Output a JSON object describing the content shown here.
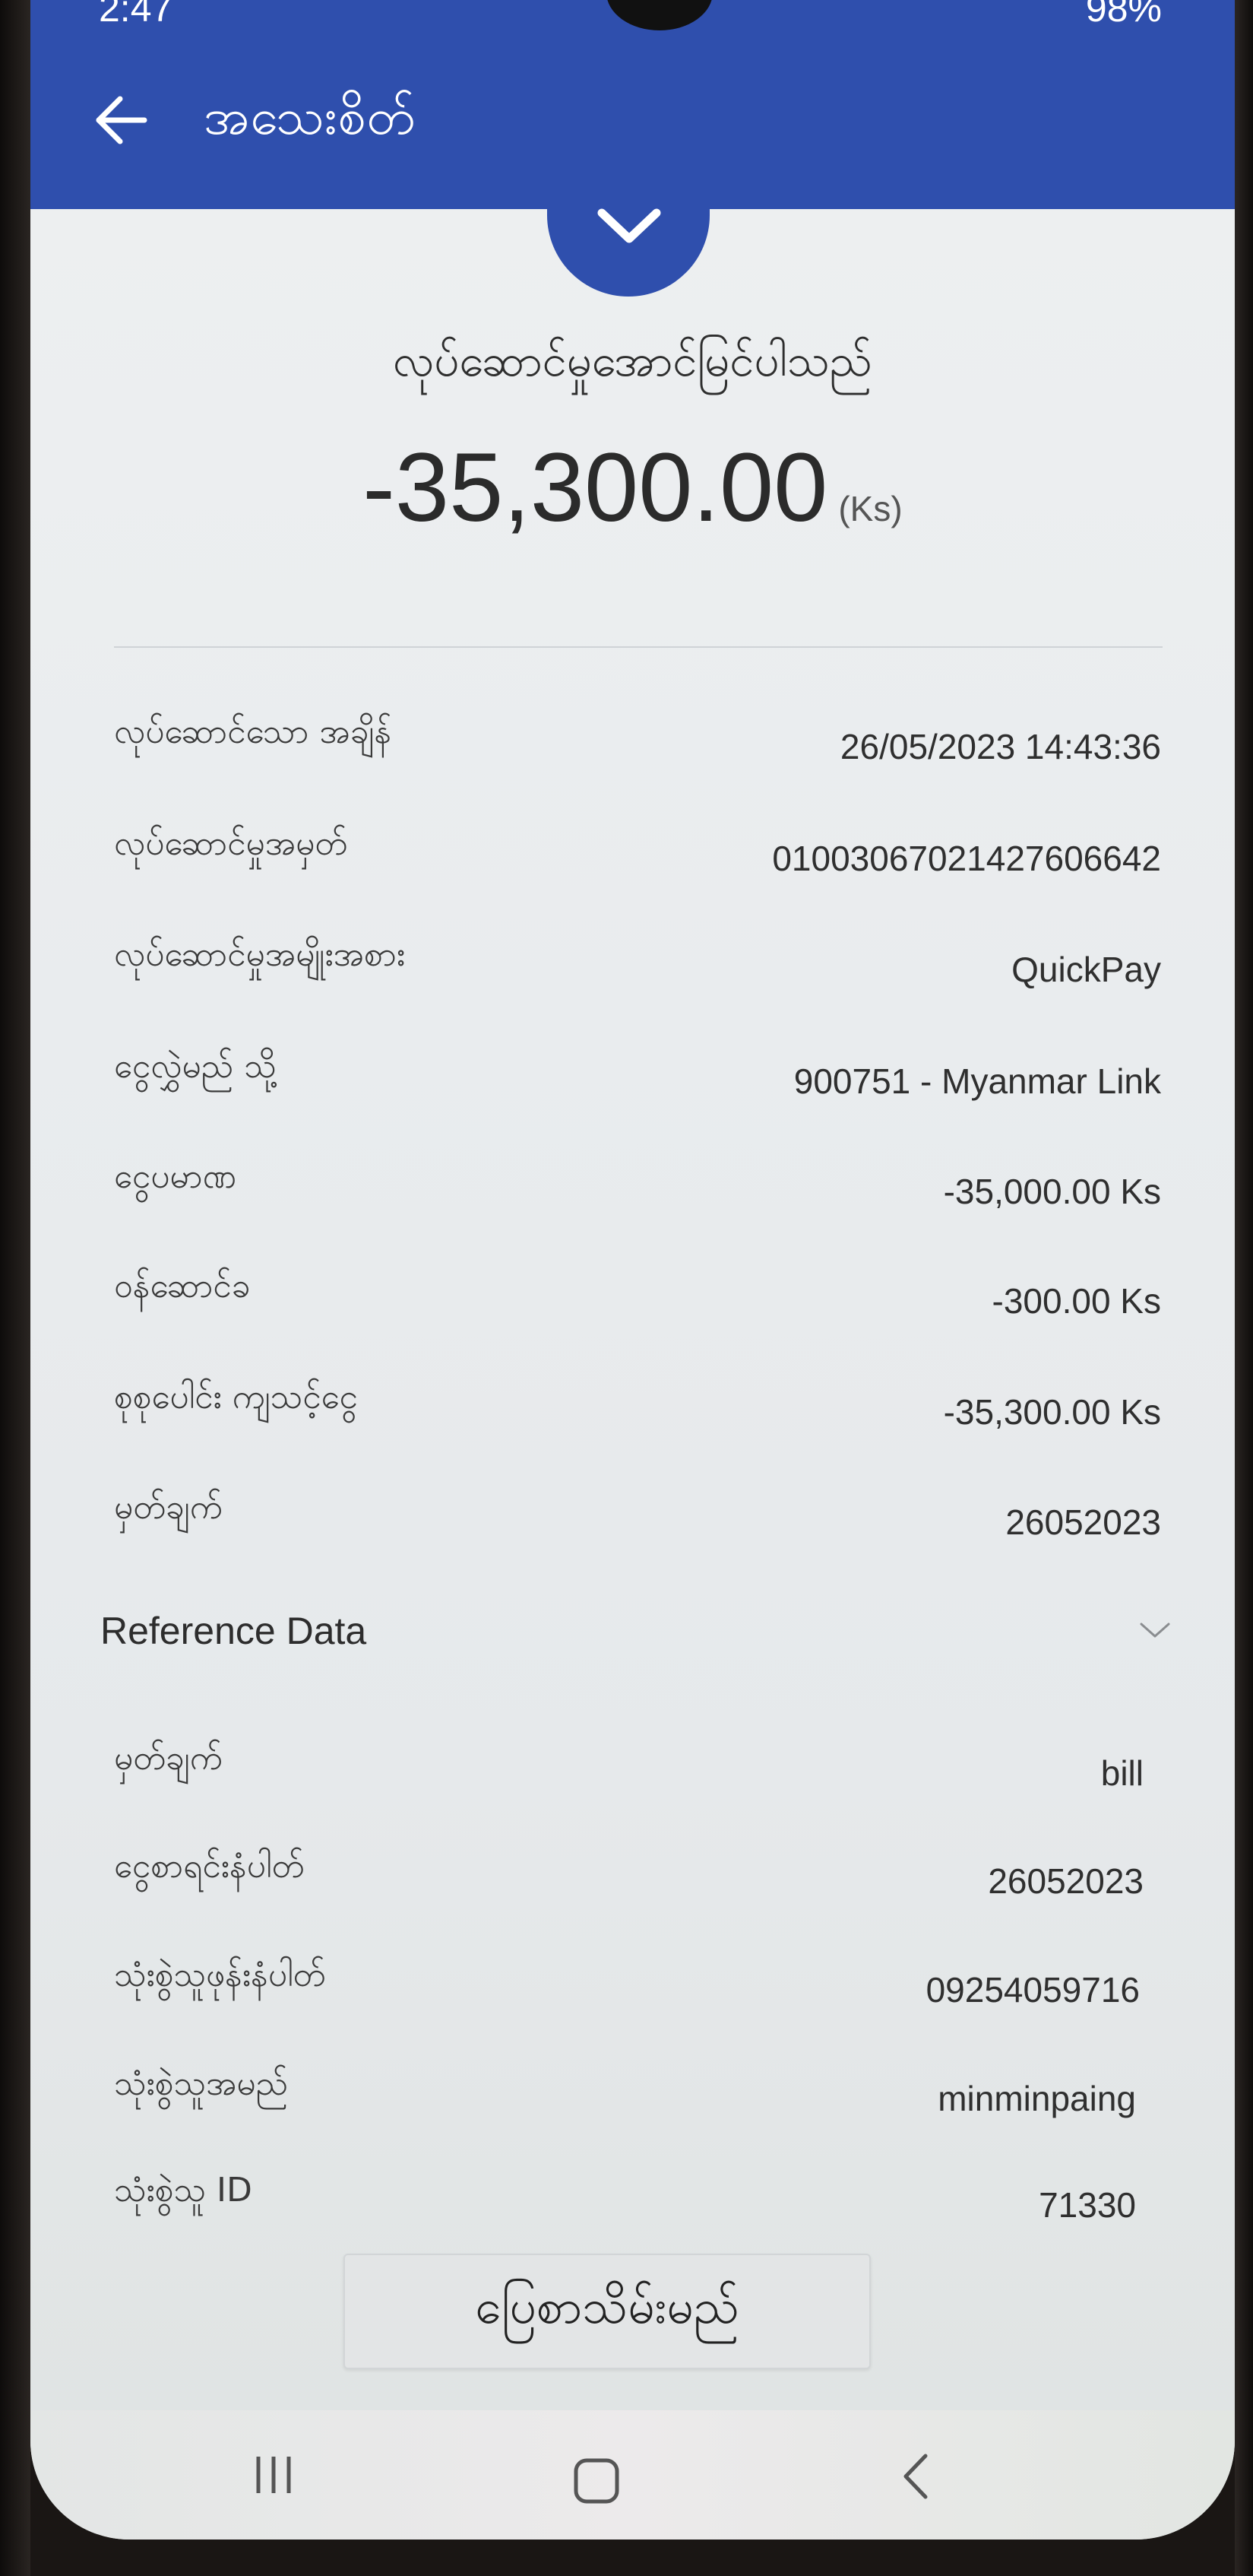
{
  "status_bar": {
    "time": "2:47",
    "battery": "98%"
  },
  "header": {
    "title": "အသေးစိတ်"
  },
  "summary": {
    "status_text": "လုပ်ဆောင်မှုအောင်မြင်ပါသည်",
    "amount": "-35,300.00",
    "currency": "(Ks)"
  },
  "details": [
    {
      "label": "လုပ်ဆောင်သော အချိန်",
      "value": "26/05/2023 14:43:36"
    },
    {
      "label": "လုပ်ဆောင်မှုအမှတ်",
      "value": "01003067021427606642"
    },
    {
      "label": "လုပ်ဆောင်မှုအမျိုးအစား",
      "value": "QuickPay"
    },
    {
      "label": "ငွေလွှဲမည် သို့",
      "value": "900751 - Myanmar Link"
    },
    {
      "label": "ငွေပမာဏ",
      "value": "-35,000.00 Ks"
    },
    {
      "label": "ဝန်ဆောင်ခ",
      "value": "-300.00 Ks"
    },
    {
      "label": "စုစုပေါင်း ကျသင့်ငွေ",
      "value": "-35,300.00 Ks"
    },
    {
      "label": "မှတ်ချက်",
      "value": "26052023"
    }
  ],
  "reference": {
    "title": "Reference Data",
    "items": [
      {
        "label": "မှတ်ချက်",
        "value": "bill"
      },
      {
        "label": "ငွေစာရင်းနံပါတ်",
        "value": "26052023"
      },
      {
        "label": "သုံးစွဲသူဖုန်းနံပါတ်",
        "value": "09254059716"
      },
      {
        "label": "သုံးစွဲသူအမည်",
        "value": "minminpaing"
      },
      {
        "label": "သုံးစွဲသူ ID",
        "value": "71330"
      }
    ]
  },
  "actions": {
    "save_receipt": "ပြေစာသိမ်းမည်"
  },
  "colors": {
    "brand_blue": "#2f4fad",
    "background": "#eceef0",
    "text": "#2f2f2f"
  },
  "icons": {
    "back": "arrow-left-icon",
    "collapse": "chevron-down-icon",
    "reference_toggle": "chevron-down-icon",
    "nav_recents": "recents-icon",
    "nav_home": "home-icon",
    "nav_back": "nav-back-icon"
  }
}
